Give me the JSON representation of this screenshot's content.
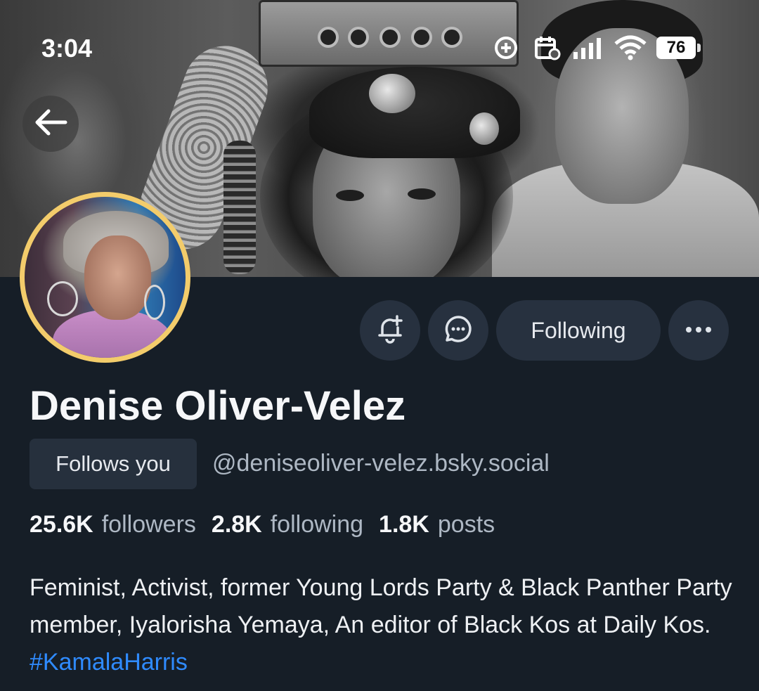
{
  "status_bar": {
    "time": "3:04",
    "battery": "76",
    "icons": [
      "data-saver-icon",
      "calendar-alarm-icon",
      "signal-icon",
      "wifi-icon",
      "battery-icon"
    ]
  },
  "navigation": {
    "back_icon": "arrow-left-icon"
  },
  "profile": {
    "display_name": "Denise Oliver-Velez",
    "follows_you_label": "Follows you",
    "handle": "@deniseoliver-velez.bsky.social",
    "stats": {
      "followers_count": "25.6K",
      "followers_label": "followers",
      "following_count": "2.8K",
      "following_label": "following",
      "posts_count": "1.8K",
      "posts_label": "posts"
    },
    "bio": {
      "text": "Feminist, Activist, former Young Lords Party & Black Panther Party member, Iyalorisha Yemaya, An editor of Black Kos at Daily Kos. ",
      "hashtag": "#KamalaHarris"
    },
    "avatar_ring_color": "#f3cc6b"
  },
  "actions": {
    "subscribe_icon": "bell-plus-icon",
    "message_icon": "chat-bubble-icon",
    "following_label": "Following",
    "more_icon": "ellipsis-icon"
  },
  "colors": {
    "background": "#161e27",
    "button_bg": "#27313f",
    "hashtag": "#2f8bff",
    "secondary_text": "#aeb8c4"
  }
}
